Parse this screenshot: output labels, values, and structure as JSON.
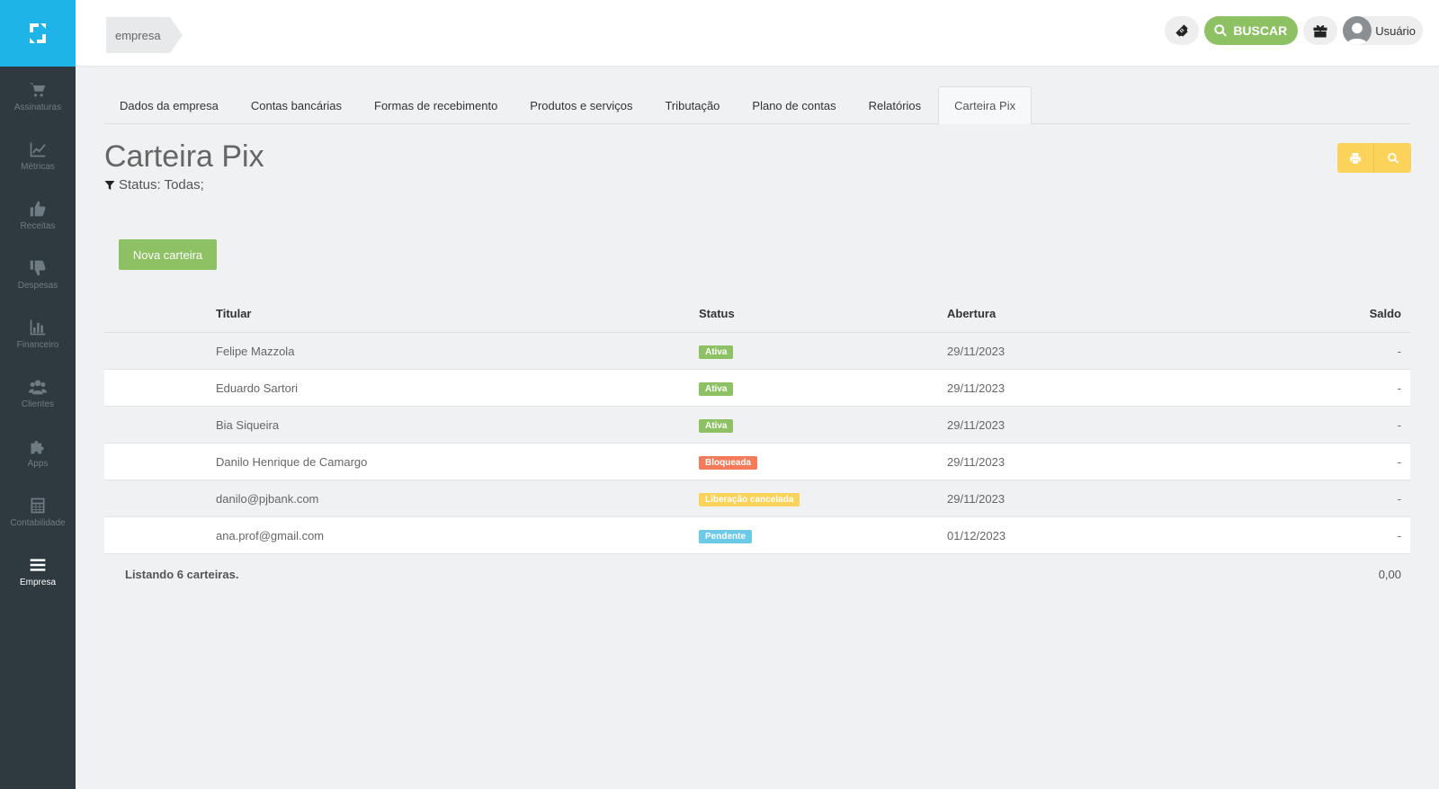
{
  "sidebar": {
    "items": [
      {
        "label": "Assinaturas",
        "icon": "cart-icon"
      },
      {
        "label": "Métricas",
        "icon": "chart-line-icon"
      },
      {
        "label": "Receitas",
        "icon": "thumbs-up-icon"
      },
      {
        "label": "Despesas",
        "icon": "thumbs-down-icon"
      },
      {
        "label": "Financeiro",
        "icon": "bar-chart-icon"
      },
      {
        "label": "Clientes",
        "icon": "users-icon"
      },
      {
        "label": "Apps",
        "icon": "puzzle-icon"
      },
      {
        "label": "Contabilidade",
        "icon": "calculator-icon"
      },
      {
        "label": "Empresa",
        "icon": "menu-icon",
        "active": true
      }
    ]
  },
  "header": {
    "breadcrumb": "empresa",
    "search_label": "BUSCAR",
    "user_label": "Usuário"
  },
  "tabs": [
    {
      "label": "Dados da empresa"
    },
    {
      "label": "Contas bancárias"
    },
    {
      "label": "Formas de recebimento"
    },
    {
      "label": "Produtos e serviços"
    },
    {
      "label": "Tributação"
    },
    {
      "label": "Plano de contas"
    },
    {
      "label": "Relatórios"
    },
    {
      "label": "Carteira Pix",
      "active": true
    }
  ],
  "page": {
    "title": "Carteira Pix",
    "filter": "Status: Todas;",
    "new_button": "Nova carteira"
  },
  "table": {
    "headers": {
      "titular": "Titular",
      "status": "Status",
      "abertura": "Abertura",
      "saldo": "Saldo"
    },
    "rows": [
      {
        "titular": "Felipe Mazzola",
        "status": "Ativa",
        "abertura": "29/11/2023",
        "saldo": "-"
      },
      {
        "titular": "Eduardo Sartori",
        "status": "Ativa",
        "abertura": "29/11/2023",
        "saldo": "-"
      },
      {
        "titular": "Bia Siqueira",
        "status": "Ativa",
        "abertura": "29/11/2023",
        "saldo": "-"
      },
      {
        "titular": "Danilo Henrique de Camargo",
        "status": "Bloqueada",
        "abertura": "29/11/2023",
        "saldo": "-"
      },
      {
        "titular": "danilo@pjbank.com",
        "status": "Liberação cancelada",
        "abertura": "29/11/2023",
        "saldo": "-"
      },
      {
        "titular": "ana.prof@gmail.com",
        "status": "Pendente",
        "abertura": "01/12/2023",
        "saldo": "-"
      }
    ],
    "footer_count": "Listando 6 carteiras.",
    "footer_total": "0,00"
  },
  "colors": {
    "sidebar_bg": "#2f3a40",
    "logo_bg": "#1fb4e8",
    "green": "#8dc163",
    "yellow": "#fcd35a",
    "status_ativa": "#8dc163",
    "status_bloqueada": "#f47b5a",
    "status_cancelada": "#fcd35a",
    "status_pendente": "#6ccae8"
  }
}
